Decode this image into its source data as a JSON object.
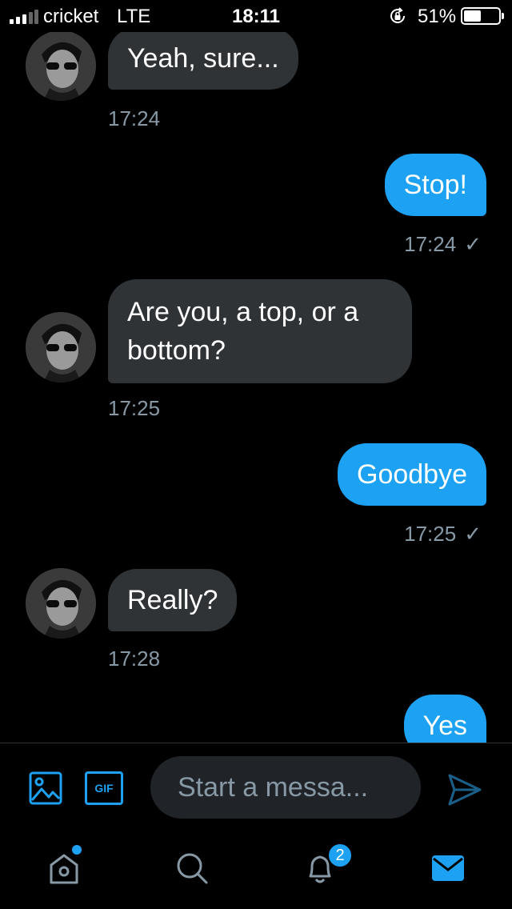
{
  "status_bar": {
    "carrier": "cricket",
    "network": "LTE",
    "time": "18:11",
    "battery_percent": "51%",
    "battery_level": 0.51
  },
  "messages": [
    {
      "direction": "in",
      "text": "Yeah, sure...",
      "time": "17:24"
    },
    {
      "direction": "out",
      "text": "Stop!",
      "time": "17:24",
      "status_icon": "check-icon"
    },
    {
      "direction": "in",
      "text": "Are you, a top, or a bottom?",
      "time": "17:25"
    },
    {
      "direction": "out",
      "text": "Goodbye",
      "time": "17:25",
      "status_icon": "check-icon"
    },
    {
      "direction": "in",
      "text": "Really?",
      "time": "17:28"
    },
    {
      "direction": "out",
      "text": "Yes"
    }
  ],
  "composer": {
    "placeholder": "Start a messa...",
    "gif_label": "GIF",
    "media_icon": "image-icon",
    "send_icon": "send-icon"
  },
  "tab_bar": {
    "tabs": [
      "home-icon",
      "search-icon",
      "bell-icon",
      "mail-icon"
    ],
    "notifications_badge": "2",
    "active": "mail-icon"
  },
  "colors": {
    "accent": "#1da1f2",
    "incoming_bubble": "#2f3336",
    "muted_text": "#8899a6",
    "background": "#000000"
  }
}
